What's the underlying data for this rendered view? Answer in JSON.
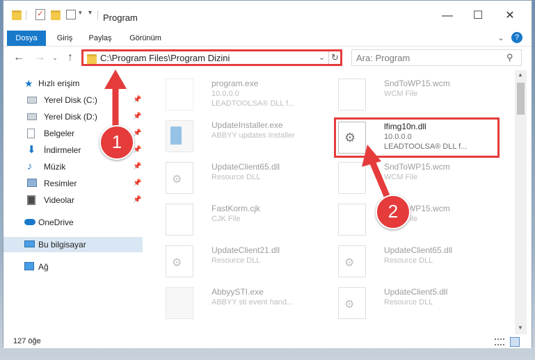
{
  "window": {
    "title": "Program"
  },
  "ribbon": {
    "tabs": [
      {
        "label": "Dosya"
      },
      {
        "label": "Giriş"
      },
      {
        "label": "Paylaş"
      },
      {
        "label": "Görünüm"
      }
    ]
  },
  "address": {
    "path": "C:\\Program Files\\Program Dizini",
    "search_placeholder": "Ara: Program"
  },
  "nav": {
    "items": [
      {
        "label": "Hızlı erişim",
        "icon": "star-icon"
      },
      {
        "label": "Yerel Disk (C:)",
        "icon": "drive-icon"
      },
      {
        "label": "Yerel Disk (D:)",
        "icon": "drive-icon"
      },
      {
        "label": "Belgeler",
        "icon": "documents-icon"
      },
      {
        "label": "İndirmeler",
        "icon": "download-icon"
      },
      {
        "label": "Müzik",
        "icon": "music-icon"
      },
      {
        "label": "Resimler",
        "icon": "pictures-icon"
      },
      {
        "label": "Videolar",
        "icon": "video-icon"
      },
      {
        "label": "OneDrive",
        "icon": "cloud-icon"
      },
      {
        "label": "Bu bilgisayar",
        "icon": "computer-icon"
      },
      {
        "label": "Ağ",
        "icon": "network-icon"
      }
    ]
  },
  "files": [
    {
      "name": "program.exe",
      "sub": "10.0.0.0",
      "sub2": "LEADTOOLSA® DLL f..."
    },
    {
      "name": "SndToWP15.wcm",
      "sub": "WCM File",
      "sub2": ""
    },
    {
      "name": "UpdateInstaller.exe",
      "sub": "ABBYY updates installer",
      "sub2": ""
    },
    {
      "name": "lfimg10n.dll",
      "sub": "10.0.0.0",
      "sub2": "LEADTOOLSA® DLL f..."
    },
    {
      "name": "UpdateClient65.dll",
      "sub": "Resource DLL",
      "sub2": ""
    },
    {
      "name": "SndToWP15.wcm",
      "sub": "WCM File",
      "sub2": ""
    },
    {
      "name": "FastKorm.cjk",
      "sub": "CJK File",
      "sub2": ""
    },
    {
      "name": "SndToWP15.wcm",
      "sub": "WCM File",
      "sub2": ""
    },
    {
      "name": "UpdateClient21.dll",
      "sub": "Resource DLL",
      "sub2": ""
    },
    {
      "name": "UpdateClient65.dll",
      "sub": "Resource DLL",
      "sub2": ""
    },
    {
      "name": "AbbyySTI.exe",
      "sub": "ABBYY sti event hand...",
      "sub2": ""
    },
    {
      "name": "UpdateClient5.dll",
      "sub": "Resource DLL",
      "sub2": ""
    }
  ],
  "status": {
    "count": "127 öğe"
  },
  "annotations": {
    "badge1": "1",
    "badge2": "2"
  },
  "colors": {
    "accent": "#1979ca",
    "highlight": "#e53b3b"
  }
}
